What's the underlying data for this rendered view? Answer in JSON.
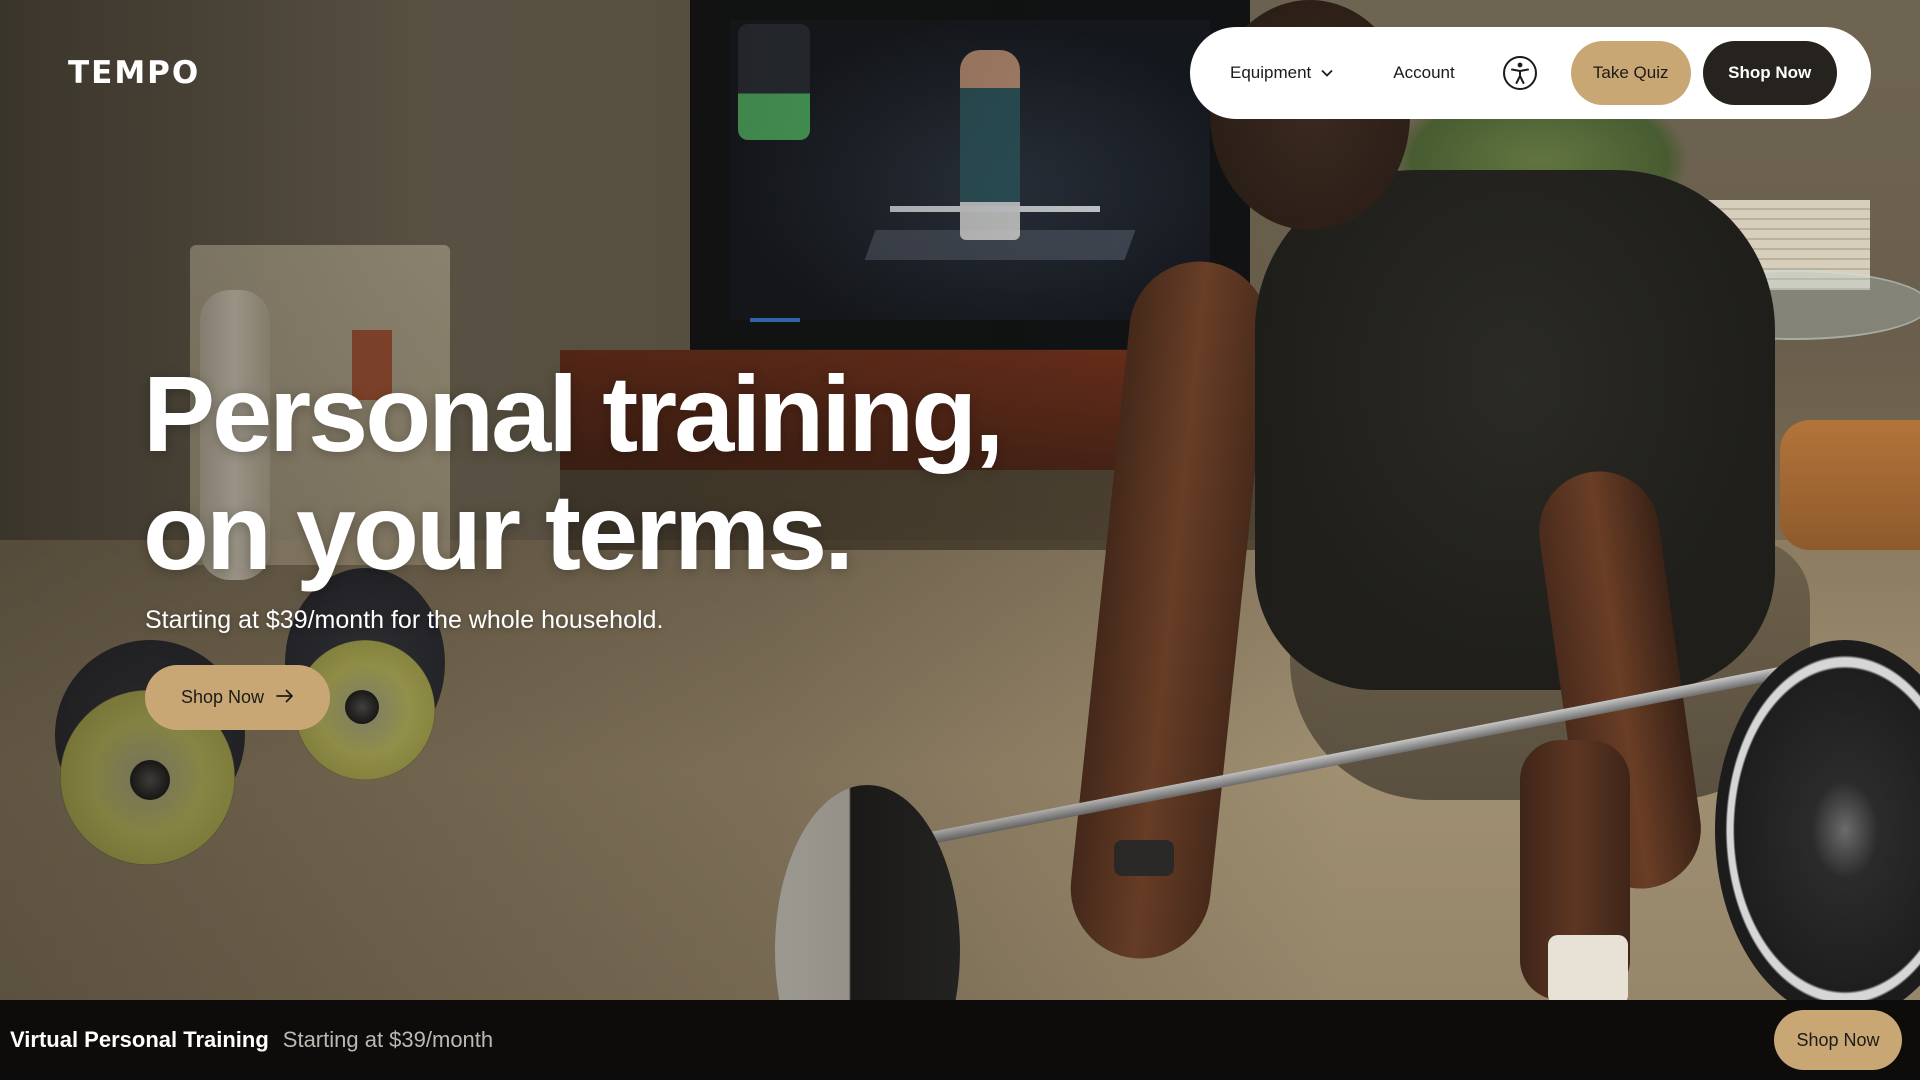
{
  "brand": {
    "logo_text": "TEMPO"
  },
  "nav": {
    "equipment_label": "Equipment",
    "account_label": "Account",
    "accessibility_icon": "accessibility-icon",
    "take_quiz_label": "Take Quiz",
    "shop_now_label": "Shop Now"
  },
  "hero": {
    "headline_line1": "Personal training,",
    "headline_line2": "on your terms.",
    "subheadline": "Starting at $39/month for the whole household.",
    "cta_label": "Shop Now",
    "cta_icon": "arrow-right-icon"
  },
  "sticky_bar": {
    "title": "Virtual Personal Training",
    "subtitle": "Starting at $39/month",
    "cta_label": "Shop Now"
  },
  "colors": {
    "accent_tan": "#c9a775",
    "dark_button": "#26231e",
    "bar_background": "#0d0c0a"
  }
}
